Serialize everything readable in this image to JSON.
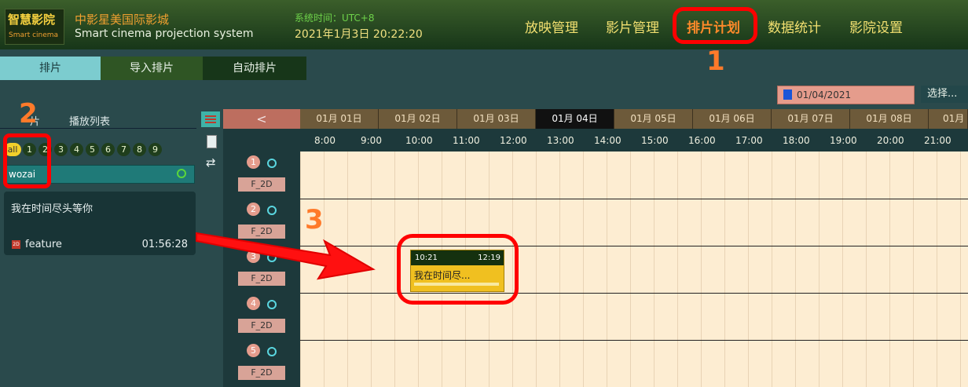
{
  "header": {
    "logo_cn": "智慧影院",
    "logo_en": "Smart cinema",
    "app_name": "中影星美国际影城",
    "app_subtitle": "Smart cinema projection system",
    "time_label": "系统时间：UTC+8",
    "time_value": "2021年1月3日 20:22:20",
    "nav": [
      "放映管理",
      "影片管理",
      "排片计划",
      "数据统计",
      "影院设置"
    ],
    "active_nav": "排片计划"
  },
  "tabs": [
    "排片",
    "导入排片",
    "自动排片"
  ],
  "date_picker": {
    "value": "01/04/2021",
    "button": "选择..."
  },
  "left_panel": {
    "tab_partial": "片",
    "tab_playlist": "播放列表",
    "filters": [
      "all",
      "1",
      "2",
      "3",
      "4",
      "5",
      "6",
      "7",
      "8",
      "9"
    ],
    "search_value": "wozai",
    "film": {
      "title": "我在时间尽头等你",
      "type": "feature",
      "duration": "01:56:28"
    }
  },
  "schedule": {
    "back": "<",
    "days": [
      "01月 01日",
      "01月 02日",
      "01月 03日",
      "01月 04日",
      "01月 05日",
      "01月 06日",
      "01月 07日",
      "01月 08日",
      "01月"
    ],
    "selected_day": "01月 04日",
    "hours": [
      "8:00",
      "9:00",
      "10:00",
      "11:00",
      "12:00",
      "13:00",
      "14:00",
      "15:00",
      "16:00",
      "17:00",
      "18:00",
      "19:00",
      "20:00",
      "21:00"
    ],
    "halls": [
      {
        "no": "1",
        "format": "F_2D"
      },
      {
        "no": "2",
        "format": "F_2D"
      },
      {
        "no": "3",
        "format": "F_2D"
      },
      {
        "no": "4",
        "format": "F_2D"
      },
      {
        "no": "5",
        "format": "F_2D"
      }
    ],
    "session": {
      "start": "10:21",
      "end": "12:19",
      "title": "我在时间尽..."
    }
  },
  "annotations": {
    "mark1": "1",
    "mark2": "2",
    "mark3": "3"
  },
  "colors": {
    "accent": "#ff7a2a",
    "annotation": "#ff0000",
    "header_bg": "#173619",
    "timeline_bg": "#fdedd2"
  }
}
